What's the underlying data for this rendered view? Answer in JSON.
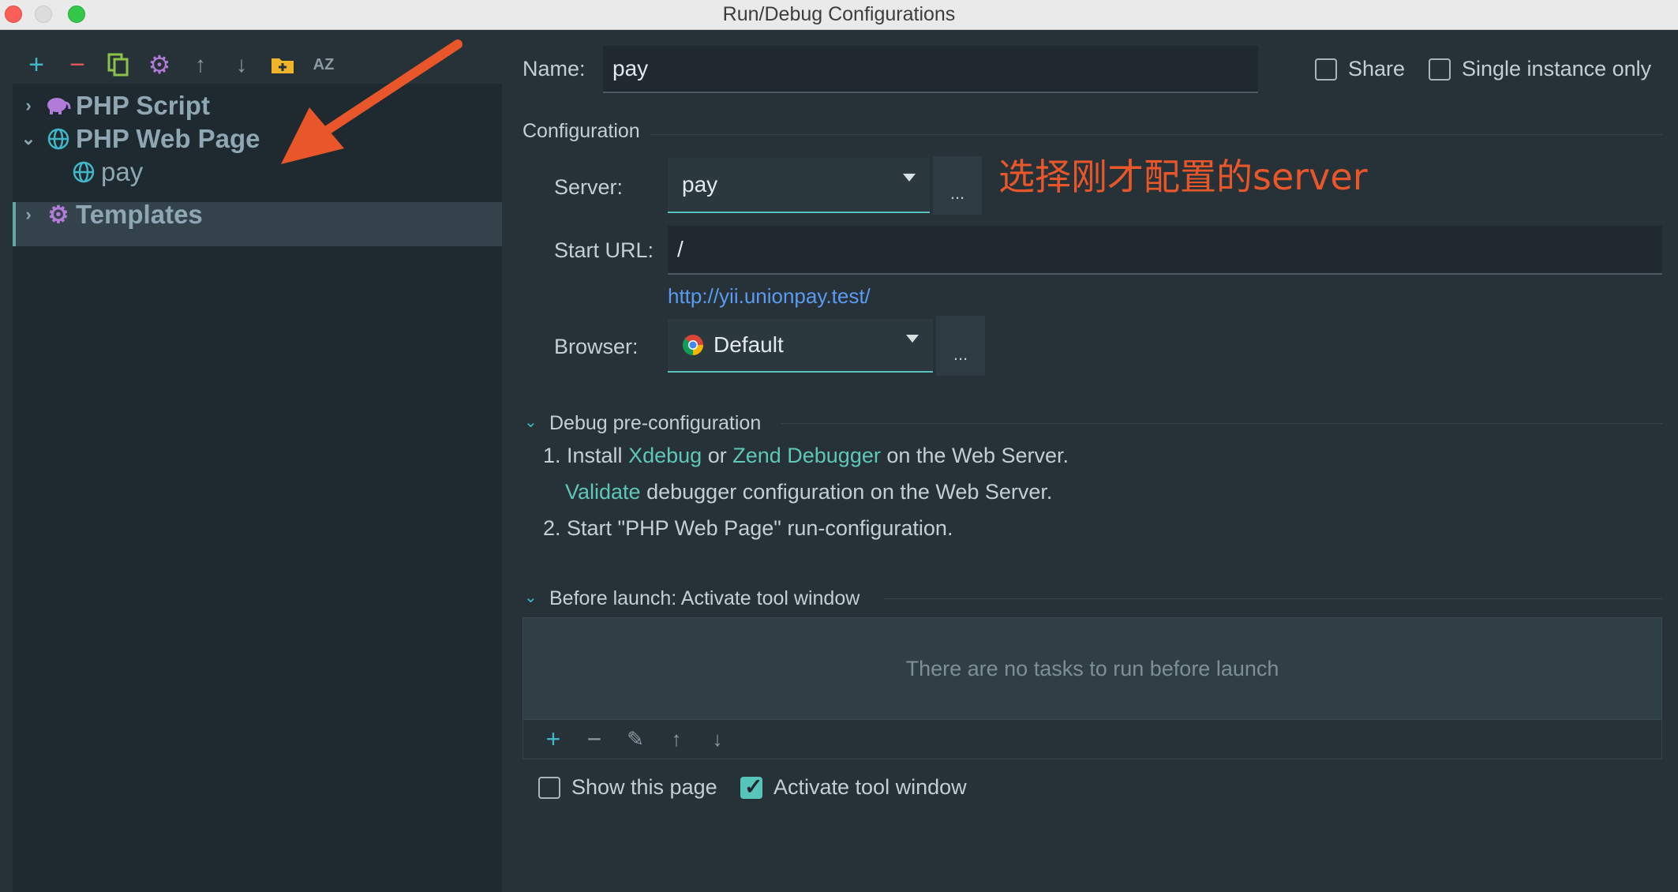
{
  "window": {
    "title": "Run/Debug Configurations"
  },
  "toolbar": {
    "icons": [
      "add-icon",
      "remove-icon",
      "copy-icon",
      "gear-icon",
      "arrow-up-icon",
      "arrow-down-icon",
      "new-folder-icon",
      "sort-az-icon"
    ],
    "colors": {
      "add": "#41b6c4",
      "remove": "#e05a58",
      "copy": "#8bc34a",
      "gear": "#b07cd8",
      "arrows": "#8c9aa1",
      "folder": "#f0b429"
    }
  },
  "tree": {
    "items": [
      {
        "label": "PHP Script",
        "expanded": false,
        "icon": "php-elephant-icon"
      },
      {
        "label": "PHP Web Page",
        "expanded": true,
        "icon": "globe-icon"
      },
      {
        "label": "pay",
        "icon": "globe-icon",
        "selected": true
      },
      {
        "label": "Templates",
        "expanded": false,
        "icon": "gear-icon"
      }
    ]
  },
  "form": {
    "name_label": "Name:",
    "name_value": "pay",
    "share_label": "Share",
    "share_checked": false,
    "single_instance_label": "Single instance only",
    "single_instance_checked": false,
    "configuration_label": "Configuration",
    "server_label": "Server:",
    "server_value": "pay",
    "server_dots": "...",
    "start_url_label": "Start URL:",
    "start_url_value": "/",
    "resolved_url": "http://yii.unionpay.test/",
    "browser_label": "Browser:",
    "browser_value": "Default",
    "browser_dots": "..."
  },
  "annotation": {
    "text": "选择刚才配置的server",
    "color": "#e8562a"
  },
  "debug": {
    "header": "Debug pre-configuration",
    "step1_prefix": "1. Install",
    "xdebug": "Xdebug",
    "or": "or",
    "zend": "Zend Debugger",
    "step1_suffix": "on the Web Server.",
    "validate": "Validate",
    "validate_suffix": "debugger configuration on the Web Server.",
    "step2": "2. Start \"PHP Web Page\" run-configuration."
  },
  "before_launch": {
    "header": "Before launch: Activate tool window",
    "empty_text": "There are no tasks to run before launch",
    "tool_icons": [
      "add-icon",
      "remove-icon",
      "edit-icon",
      "arrow-up-icon",
      "arrow-down-icon"
    ],
    "show_page_label": "Show this page",
    "show_page_checked": false,
    "activate_label": "Activate tool window",
    "activate_checked": true
  }
}
